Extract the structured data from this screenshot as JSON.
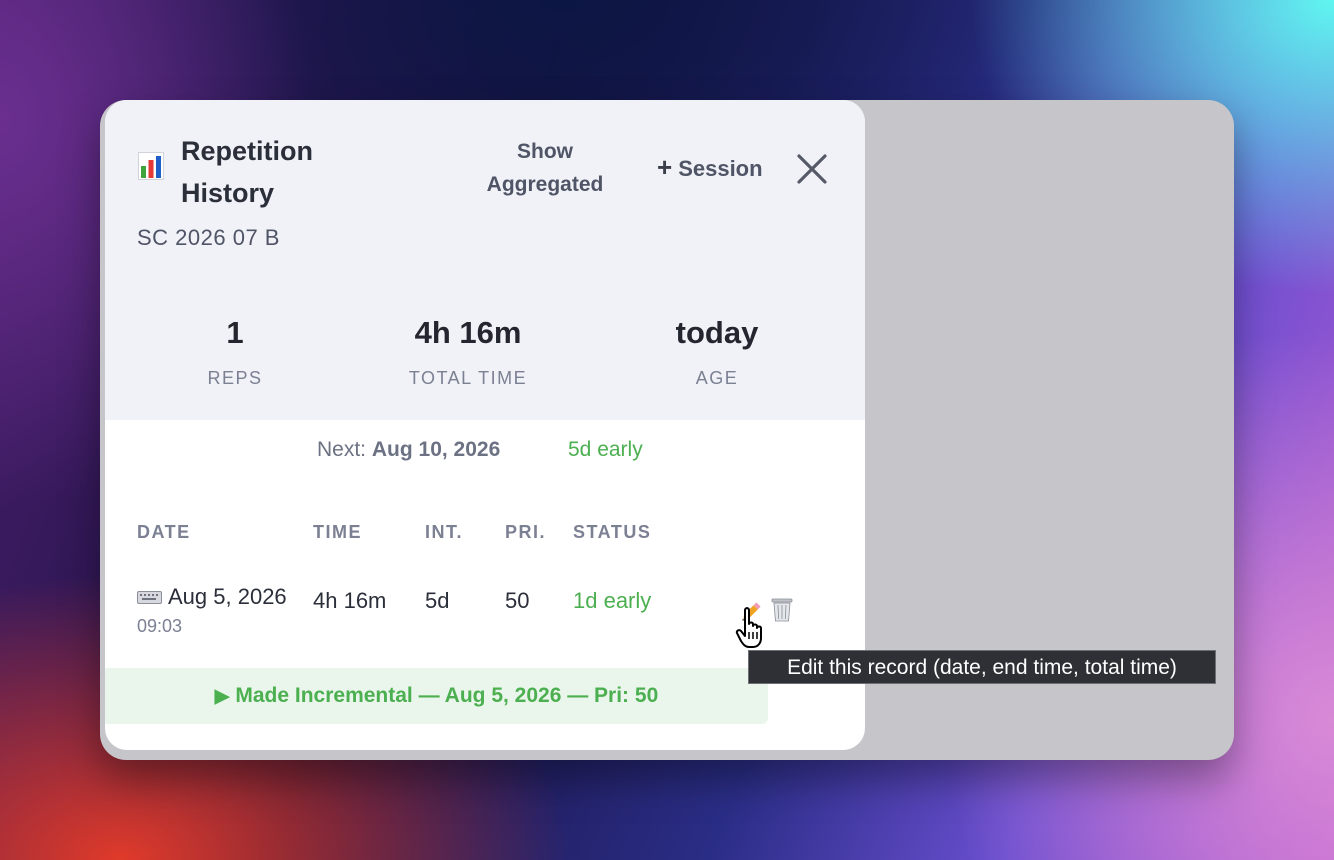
{
  "dialog": {
    "title": "Repetition History",
    "subtitle": "SC 2026 07 B",
    "show_aggregated_label": "Show Aggregated",
    "session_label": "Session",
    "session_plus": "+",
    "icons": {
      "title": "bar-chart-icon",
      "close": "close-icon"
    }
  },
  "stats": [
    {
      "value": "1",
      "label": "REPS"
    },
    {
      "value": "4h 16m",
      "label": "TOTAL TIME"
    },
    {
      "value": "today",
      "label": "AGE"
    }
  ],
  "next": {
    "label": "Next:",
    "date": "Aug 10, 2026",
    "early": "5d early"
  },
  "table": {
    "headers": [
      "DATE",
      "TIME",
      "INT.",
      "PRI.",
      "STATUS"
    ],
    "rows": [
      {
        "date": "Aug 5, 2026",
        "clock": "09:03",
        "time": "4h 16m",
        "interval": "5d",
        "priority": "50",
        "status": "1d early",
        "icons": {
          "source": "keyboard-icon",
          "edit": "pencil-icon",
          "delete": "trash-icon"
        }
      }
    ]
  },
  "banner": {
    "play": "▶",
    "text": "Made Incremental — Aug 5, 2026 — Pri: 50"
  },
  "tooltip": "Edit this record (date, end time, total time)",
  "colors": {
    "accent_green": "#4caf50",
    "header_bg": "#f0f2f7",
    "banner_bg": "#eaf6ec",
    "tooltip_bg": "#2e3035"
  }
}
